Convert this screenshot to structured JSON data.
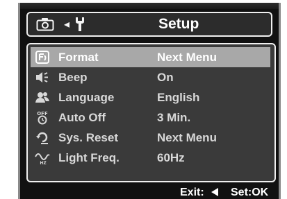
{
  "header": {
    "title": "Setup",
    "tab_arrow": "◂",
    "icons": [
      "camera-icon",
      "wrench-icon"
    ]
  },
  "menu": {
    "items": [
      {
        "label": "Format",
        "value": "Next Menu",
        "icon": "format-icon",
        "selected": true
      },
      {
        "label": "Beep",
        "value": "On",
        "icon": "speaker-icon",
        "selected": false
      },
      {
        "label": "Language",
        "value": "English",
        "icon": "people-icon",
        "selected": false
      },
      {
        "label": "Auto Off",
        "value": "3 Min.",
        "icon": "auto-off-icon",
        "selected": false
      },
      {
        "label": "Sys. Reset",
        "value": "Next Menu",
        "icon": "reset-icon",
        "selected": false
      },
      {
        "label": "Light Freq.",
        "value": "60Hz",
        "icon": "frequency-icon",
        "selected": false
      }
    ]
  },
  "footer": {
    "exit_label": "Exit:",
    "set_label": "Set:OK"
  },
  "icon_texts": {
    "auto_off": "OFF",
    "hz": "HZ"
  },
  "colors": {
    "background": "#111111",
    "menu_background": "#3a3a3a",
    "selection": "#a8a8a8",
    "text": "#ffffff"
  }
}
